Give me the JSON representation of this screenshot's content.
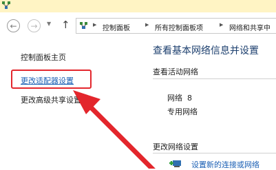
{
  "window": {
    "app_icon": "control-panel-network-icon"
  },
  "toolbar": {
    "back_glyph": "←",
    "forward_glyph": "→",
    "dropdown_glyph": "▼",
    "up_glyph": "↑"
  },
  "address_bar": {
    "icon": "network-folder-icon",
    "breadcrumbs": [
      "控制面板",
      "所有控制面板项",
      "网络和共享中"
    ]
  },
  "sidebar": {
    "home": "控制面板主页",
    "items": [
      {
        "label": "更改适配器设置",
        "style": "link"
      },
      {
        "label": "更改高级共享设置",
        "style": "text"
      }
    ]
  },
  "main": {
    "title": "查看基本网络信息并设置",
    "active_networks_heading": "查看活动网络",
    "network": {
      "name": "网络  8",
      "type": "专用网络"
    },
    "change_settings_heading": "更改网络设置",
    "setup_link": "设置新的连接或网络"
  },
  "annotation": {
    "color": "#e3262c"
  }
}
